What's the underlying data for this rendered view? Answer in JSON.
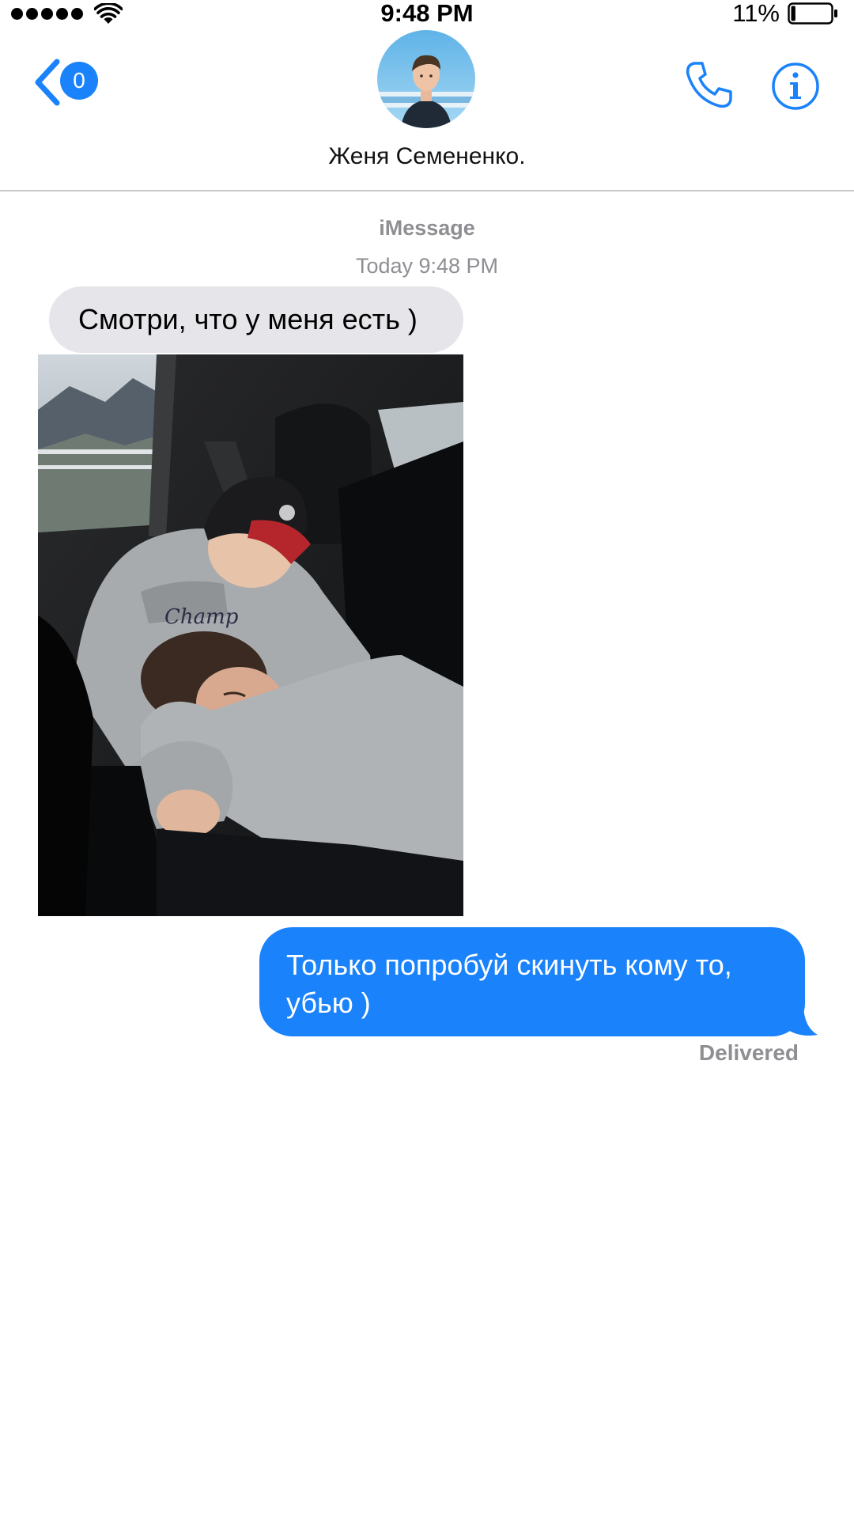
{
  "status_bar": {
    "time": "9:48 PM",
    "battery_percent": "11%",
    "battery_level": 0.11,
    "signal_bars": 5,
    "wifi_icon": "wifi-icon",
    "battery_icon": "battery-icon"
  },
  "header": {
    "back_icon": "chevron-left-icon",
    "unread_count": "0",
    "contact_name": "Женя Семененко.",
    "call_icon": "phone-icon",
    "info_icon": "info-icon"
  },
  "conversation": {
    "service": "iMessage",
    "timestamp": "Today 9:48 PM",
    "messages": [
      {
        "direction": "incoming",
        "type": "text",
        "text": "Смотри, что у меня есть )"
      },
      {
        "direction": "incoming",
        "type": "photo"
      },
      {
        "direction": "outgoing",
        "type": "text",
        "text": "Только попробуй скинуть кому то, убью )",
        "status": "Delivered"
      }
    ]
  },
  "colors": {
    "accent": "#1a82fb",
    "incoming_bubble": "#e5e5ea",
    "outgoing_bubble": "#1a82fb",
    "secondary_text": "#8e8e93",
    "divider": "#c8c8cc"
  }
}
